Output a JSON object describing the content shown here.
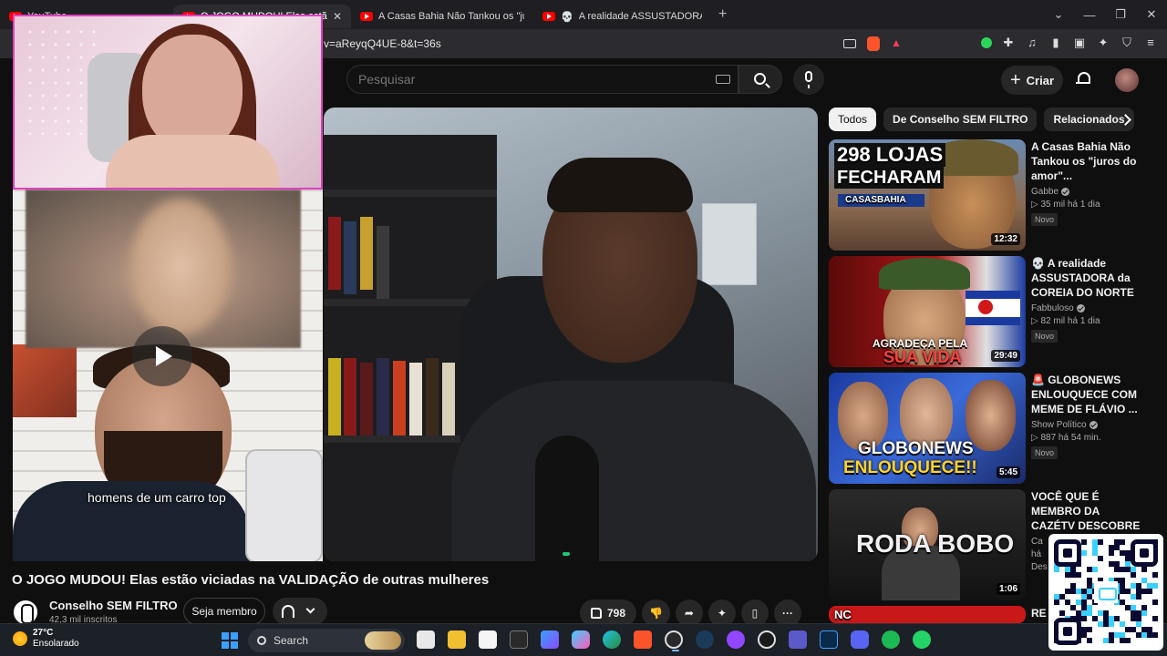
{
  "browser": {
    "tabs": [
      {
        "label": "YouTube",
        "type": "youtube",
        "active": false
      },
      {
        "label": "O JOGO MUDOU! Elas estão viciadas",
        "type": "youtube",
        "active": true
      },
      {
        "label": "A Casas Bahia Não Tankou os \"juros",
        "type": "youtube",
        "active": false
      },
      {
        "label": "A realidade ASSUSTADORA da CO",
        "type": "skull",
        "active": false
      }
    ],
    "url": "v=aReyqQ4UE-8&t=36s"
  },
  "header": {
    "search_placeholder": "Pesquisar",
    "create_label": "Criar"
  },
  "player": {
    "caption": "homens de um carro top"
  },
  "chips": [
    "Todos",
    "De Conselho SEM FILTRO",
    "Relacionados"
  ],
  "recommendations": [
    {
      "title": "A Casas Bahia Não Tankou os \"juros do amor\"...",
      "channel": "Gabbe",
      "verified": true,
      "meta": "▷ 35 mil  há 1 dia",
      "badge": "Novo",
      "duration": "12:32",
      "thumb_text": [
        "298 LOJAS",
        "FECHARAM"
      ],
      "thumb_sign": "CASASBAHIA"
    },
    {
      "title": "💀 A realidade ASSUSTADORA da COREIA DO NORTE KP",
      "channel": "Fabbuloso",
      "verified": true,
      "meta": "▷ 82 mil  há 1 dia",
      "badge": "Novo",
      "duration": "29:49",
      "thumb_text": [
        "AGRADEÇA PELA",
        "SUA VIDA"
      ]
    },
    {
      "title": "🚨 GLOBONEWS ENLOUQUECE COM MEME DE FLÁVIO ...",
      "channel": "Show Político",
      "verified": true,
      "meta": "▷ 887  há 54 min.",
      "badge": "Novo",
      "duration": "5:45",
      "thumb_text": [
        "GLOBONEWS",
        "ENLOUQUECE!!"
      ]
    },
    {
      "title": "VOCÊ QUE É MEMBRO DA CAZÉTV DESCOBRE AGORA QUAL O JOGO ...",
      "channel": "Ca",
      "verified": false,
      "meta": "há",
      "badge": "Des",
      "duration": "1:06",
      "thumb_text": [
        "RODA BOBO"
      ]
    },
    {
      "title": "RE",
      "thumb_text": [
        "NC"
      ]
    }
  ],
  "video": {
    "title": "O JOGO MUDOU! Elas estão viciadas na VALIDAÇÃO de outras mulheres",
    "channel_name": "Conselho SEM FILTRO",
    "subscribers": "42,3 mil inscritos",
    "join_label": "Seja membro",
    "likes": "798"
  },
  "taskbar": {
    "temperature": "27°C",
    "condition": "Ensolarado",
    "search_label": "Search"
  },
  "colors": {
    "youtube_red": "#ff0000",
    "overlay_border": "#e040c0",
    "background": "#0f0f0f"
  }
}
